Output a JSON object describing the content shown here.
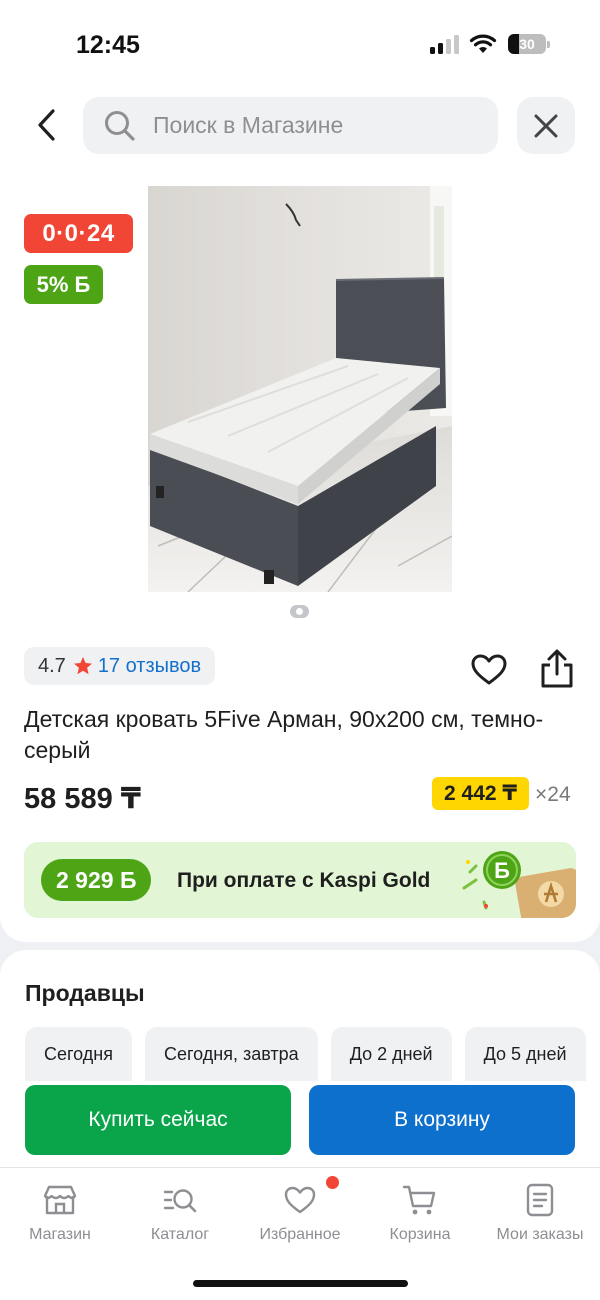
{
  "status_bar": {
    "time": "12:45",
    "battery": "30",
    "battery_level": 0.3
  },
  "header": {
    "search_placeholder": "Поиск в Магазине"
  },
  "badges": {
    "installment": "0·0·24",
    "bonus": "5% Б"
  },
  "product": {
    "rating": "4.7",
    "reviews": "17 отзывов",
    "title": "Детская кровать 5Five Арман, 90x200 см, темно-серый",
    "price": "58 589 ₸",
    "monthly_payment": "2 442 ₸",
    "months": "×24"
  },
  "kaspi_gold": {
    "bonus": "2 929 Б",
    "text": "При оплате с Kaspi Gold"
  },
  "sellers": {
    "title": "Продавцы",
    "filters": [
      "Сегодня",
      "Сегодня, завтра",
      "До 2 дней",
      "До 5 дней"
    ]
  },
  "actions": {
    "buy_now": "Купить сейчас",
    "add_to_cart": "В корзину"
  },
  "tabbar": {
    "items": [
      {
        "label": "Магазин",
        "icon": "shop-icon"
      },
      {
        "label": "Каталог",
        "icon": "catalog-icon"
      },
      {
        "label": "Избранное",
        "icon": "heart-icon"
      },
      {
        "label": "Корзина",
        "icon": "cart-icon"
      },
      {
        "label": "Мои заказы",
        "icon": "orders-icon"
      }
    ]
  },
  "colors": {
    "installment_red": "#f14635",
    "bonus_green": "#4da516",
    "buy_green": "#0aa54b",
    "cart_blue": "#0d70cc",
    "monthly_yellow": "#ffd600",
    "link_blue": "#1471cc"
  }
}
